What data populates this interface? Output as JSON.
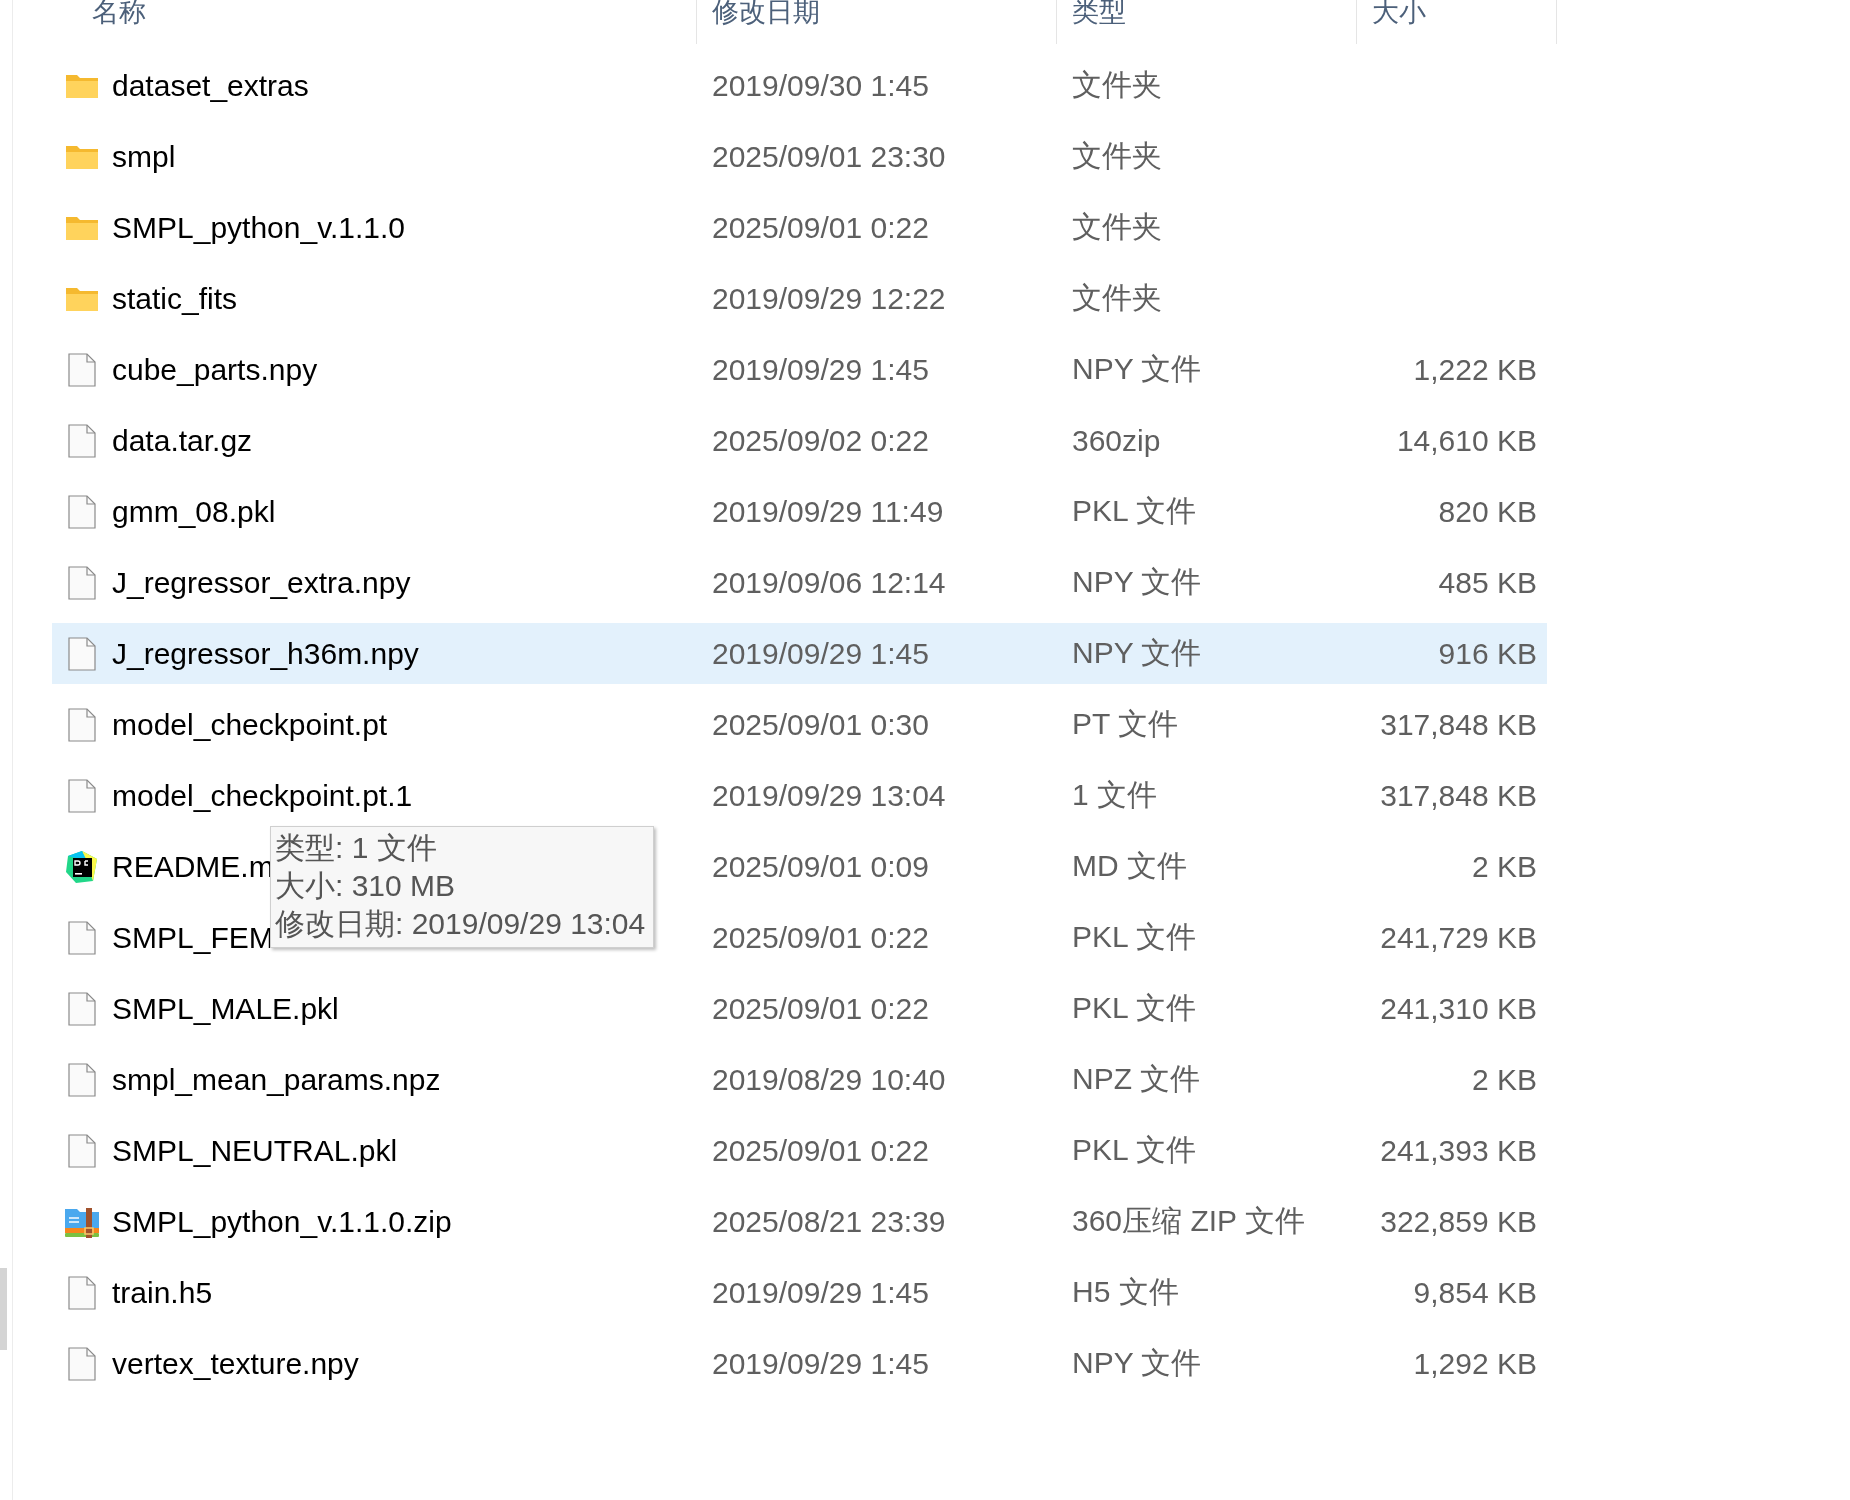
{
  "columns": [
    "名称",
    "修改日期",
    "类型",
    "大小"
  ],
  "files": [
    {
      "name": "dataset_extras",
      "date": "2019/09/30 1:45",
      "type": "文件夹",
      "kind": "folder",
      "selected": false
    },
    {
      "name": "smpl",
      "date": "2025/09/01 23:30",
      "type": "文件夹",
      "kind": "folder",
      "selected": false
    },
    {
      "name": "SMPL_python_v.1.1.0",
      "date": "2025/09/01 0:22",
      "type": "文件夹",
      "kind": "folder",
      "selected": false
    },
    {
      "name": "static_fits",
      "date": "2019/09/29 12:22",
      "type": "文件夹",
      "kind": "folder",
      "selected": false
    },
    {
      "name": "cube_parts.npy",
      "date": "2019/09/29 1:45",
      "type": "NPY 文件",
      "size": "1,222 KB",
      "kind": "file",
      "selected": false
    },
    {
      "name": "data.tar.gz",
      "date": "2025/09/02 0:22",
      "type": "360zip",
      "size": "14,610 KB",
      "kind": "file",
      "selected": false
    },
    {
      "name": "gmm_08.pkl",
      "date": "2019/09/29 11:49",
      "type": "PKL 文件",
      "size": "820 KB",
      "kind": "file",
      "selected": false
    },
    {
      "name": "J_regressor_extra.npy",
      "date": "2019/09/06 12:14",
      "type": "NPY 文件",
      "size": "485 KB",
      "kind": "file",
      "selected": false
    },
    {
      "name": "J_regressor_h36m.npy",
      "date": "2019/09/29 1:45",
      "type": "NPY 文件",
      "size": "916 KB",
      "kind": "file",
      "selected": true
    },
    {
      "name": "model_checkpoint.pt",
      "date": "2025/09/01 0:30",
      "type": "PT 文件",
      "size": "317,848 KB",
      "kind": "file",
      "selected": false
    },
    {
      "name": "model_checkpoint.pt.1",
      "date": "2019/09/29 13:04",
      "type": "1 文件",
      "size": "317,848 KB",
      "kind": "file",
      "selected": false
    },
    {
      "name": "README.m",
      "date": "2025/09/01 0:09",
      "type": "MD 文件",
      "size": "2 KB",
      "kind": "pycharm",
      "selected": false
    },
    {
      "name": "SMPL_FEM",
      "date": "2025/09/01 0:22",
      "type": "PKL 文件",
      "size": "241,729 KB",
      "kind": "file",
      "selected": false
    },
    {
      "name": "SMPL_MALE.pkl",
      "date": "2025/09/01 0:22",
      "type": "PKL 文件",
      "size": "241,310 KB",
      "kind": "file",
      "selected": false
    },
    {
      "name": "smpl_mean_params.npz",
      "date": "2019/08/29 10:40",
      "type": "NPZ 文件",
      "size": "2 KB",
      "kind": "file",
      "selected": false
    },
    {
      "name": "SMPL_NEUTRAL.pkl",
      "date": "2025/09/01 0:22",
      "type": "PKL 文件",
      "size": "241,393 KB",
      "kind": "file",
      "selected": false
    },
    {
      "name": "SMPL_python_v.1.1.0.zip",
      "date": "2025/08/21 23:39",
      "type": "360压缩 ZIP 文件",
      "size": "322,859 KB",
      "kind": "archive",
      "selected": false
    },
    {
      "name": "train.h5",
      "date": "2019/09/29 1:45",
      "type": "H5 文件",
      "size": "9,854 KB",
      "kind": "file",
      "selected": false
    },
    {
      "name": "vertex_texture.npy",
      "date": "2019/09/29 1:45",
      "type": "NPY 文件",
      "size": "1,292 KB",
      "kind": "file",
      "selected": false
    }
  ],
  "tooltip": [
    "类型: 1 文件",
    "大小: 310 MB",
    "修改日期: 2019/09/29 13:04"
  ]
}
